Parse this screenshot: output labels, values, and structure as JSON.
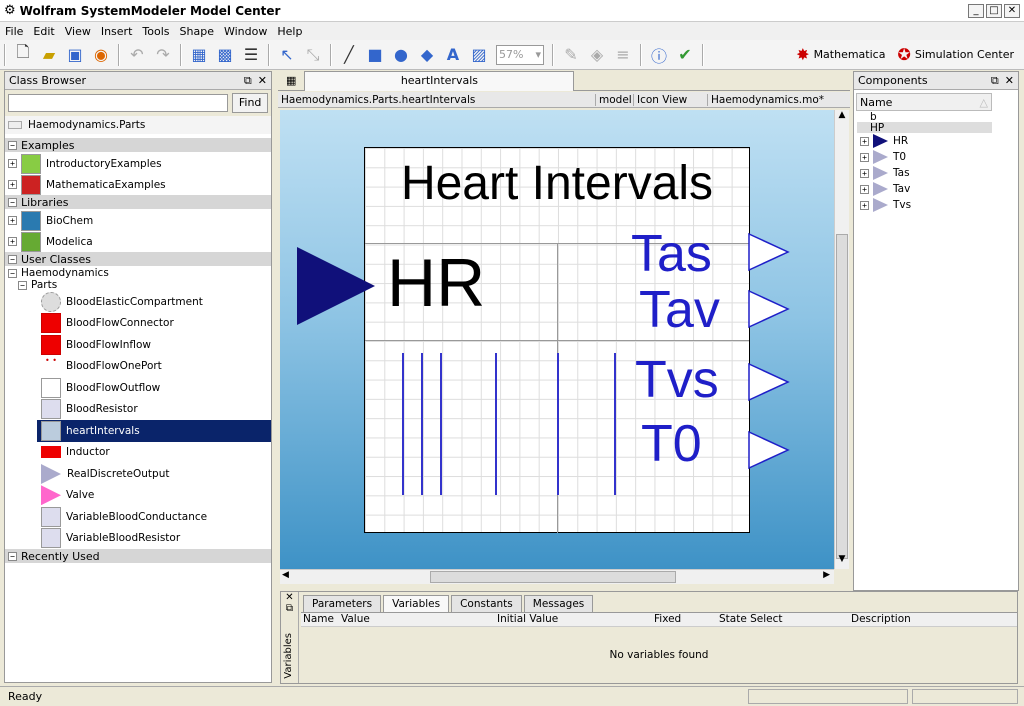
{
  "window": {
    "title": "Wolfram SystemModeler Model Center"
  },
  "menu": [
    "File",
    "Edit",
    "View",
    "Insert",
    "Tools",
    "Shape",
    "Window",
    "Help"
  ],
  "toolbar": {
    "zoom": "57%",
    "mathematica": "Mathematica",
    "simcenter": "Simulation Center"
  },
  "class_browser": {
    "title": "Class Browser",
    "search_placeholder": "",
    "find_label": "Find",
    "root": "Haemodynamics.Parts",
    "groups": {
      "examples": "Examples",
      "libraries": "Libraries",
      "user_classes": "User Classes",
      "recently_used": "Recently Used"
    },
    "example_items": [
      "IntroductoryExamples",
      "MathematicaExamples"
    ],
    "library_items": [
      "BioChem",
      "Modelica"
    ],
    "haemo": "Haemodynamics",
    "parts": "Parts",
    "part_items": [
      "BloodElasticCompartment",
      "BloodFlowConnector",
      "BloodFlowInflow",
      "BloodFlowOnePort",
      "BloodFlowOutflow",
      "BloodResistor",
      "heartIntervals",
      "Inductor",
      "RealDiscreteOutput",
      "Valve",
      "VariableBloodConductance",
      "VariableBloodResistor"
    ],
    "selected": "heartIntervals"
  },
  "editor": {
    "tab": "heartIntervals",
    "path": "Haemodynamics.Parts.heartIntervals",
    "kind": "model",
    "view": "Icon View",
    "file": "Haemodynamics.mo*",
    "icon_title": "Heart Intervals",
    "input_label": "HR",
    "outputs": [
      "Tas",
      "Tav",
      "Tvs",
      "T0"
    ]
  },
  "components": {
    "title": "Components",
    "col_name": "Name",
    "items": [
      "b",
      "HP",
      "HR",
      "T0",
      "Tas",
      "Tav",
      "Tvs"
    ]
  },
  "bottom": {
    "tabs": [
      "Parameters",
      "Variables",
      "Constants",
      "Messages"
    ],
    "active_tab": "Variables",
    "columns": [
      "Name",
      "Value",
      "Initial Value",
      "Fixed",
      "State Select",
      "Description"
    ],
    "empty": "No variables found",
    "side_label": "Variables"
  },
  "status": "Ready",
  "colors": {
    "selection": "#0a246a",
    "canvas": "#4a9fcf",
    "blue_text": "#1f1fc8"
  }
}
